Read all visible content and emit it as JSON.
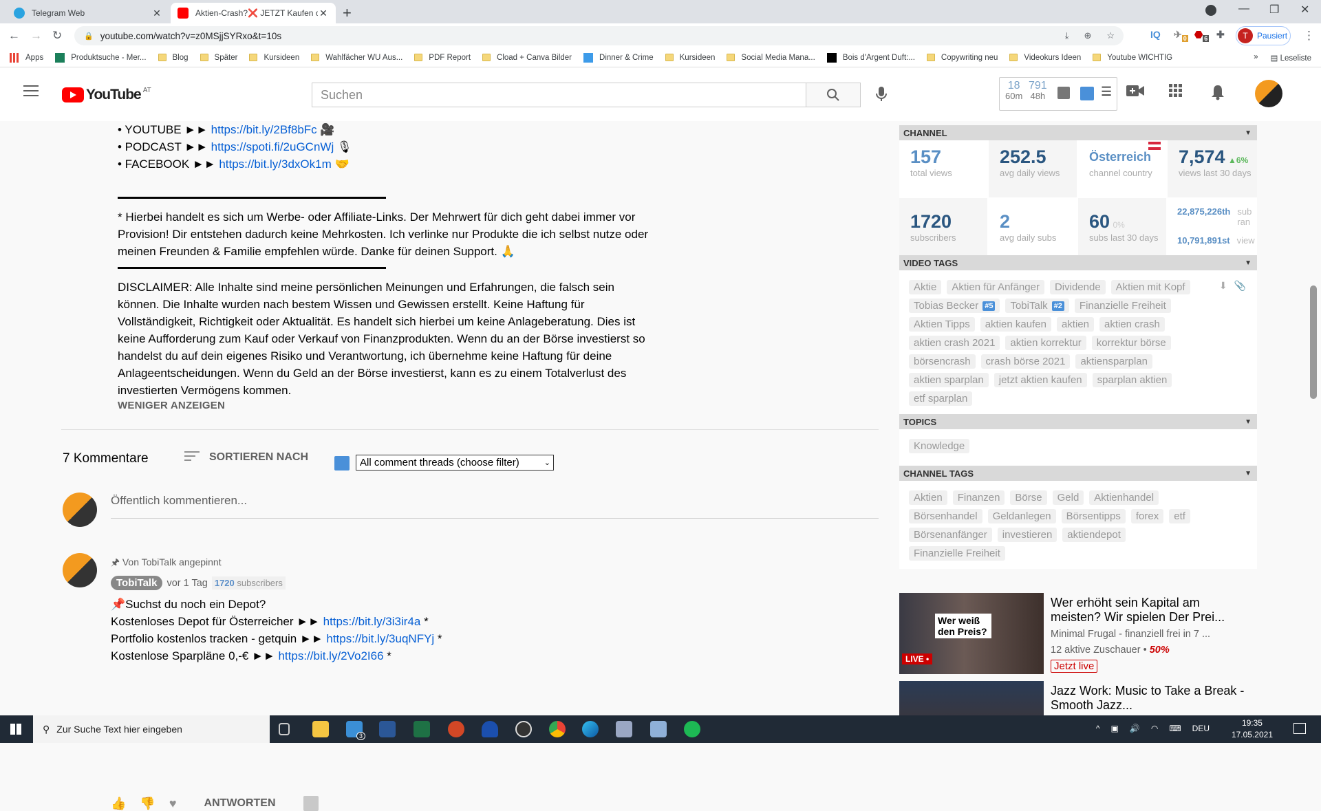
{
  "browser": {
    "tabs": [
      {
        "title": "Telegram Web",
        "active": false
      },
      {
        "title": "Aktien-Crash?❌ JETZT Kaufen o",
        "active": true
      }
    ],
    "url": "youtube.com/watch?v=z0MSjjSYRxo&t=10s",
    "profile_label": "Pausiert",
    "profile_initial": "T",
    "ext_badges": {
      "vidiq": "IQ",
      "ext1_count": "0",
      "adblock_count": "6"
    },
    "bookmarks": [
      {
        "label": "Apps",
        "type": "apps"
      },
      {
        "label": "Produktsuche - Mer...",
        "type": "site"
      },
      {
        "label": "Blog",
        "type": "folder"
      },
      {
        "label": "Später",
        "type": "folder"
      },
      {
        "label": "Kursideen",
        "type": "folder"
      },
      {
        "label": "Wahlfächer WU Aus...",
        "type": "folder"
      },
      {
        "label": "PDF Report",
        "type": "folder"
      },
      {
        "label": "Cload + Canva Bilder",
        "type": "folder"
      },
      {
        "label": "Dinner & Crime",
        "type": "site"
      },
      {
        "label": "Kursideen",
        "type": "folder"
      },
      {
        "label": "Social Media Mana...",
        "type": "folder"
      },
      {
        "label": "Bois d'Argent Duft:...",
        "type": "site"
      },
      {
        "label": "Copywriting neu",
        "type": "folder"
      },
      {
        "label": "Videokurs Ideen",
        "type": "folder"
      },
      {
        "label": "Youtube WICHTIG",
        "type": "folder"
      }
    ],
    "more_bookmarks": "»",
    "reading_list": "Leseliste"
  },
  "youtube": {
    "logo_text": "YouTube",
    "region": "AT",
    "search_placeholder": "Suchen",
    "vidiq_stats": [
      {
        "value": "18",
        "label": "60m"
      },
      {
        "value": "791",
        "label": "48h"
      }
    ]
  },
  "description": {
    "links": [
      {
        "label": "• YOUTUBE ►► ",
        "url": "https://bit.ly/2Bf8bFc",
        "emoji": "🎥"
      },
      {
        "label": "• PODCAST ►► ",
        "url": "https://spoti.fi/2uGCnWj",
        "emoji": "🎙"
      },
      {
        "label": "• FACEBOOK ►► ",
        "url": "https://bit.ly/3dxOk1m",
        "emoji": "🤝"
      }
    ],
    "affiliate_note": "* Hierbei handelt es sich um Werbe- oder Affiliate-Links. Der Mehrwert für dich geht dabei immer vor Provision! Dir entstehen dadurch keine Mehrkosten. Ich verlinke nur Produkte die ich selbst nutze oder meinen Freunden & Familie empfehlen würde. Danke für deinen Support. 🙏",
    "disclaimer": "DISCLAIMER: Alle Inhalte sind meine persönlichen Meinungen und Erfahrungen, die falsch sein können. Die Inhalte wurden nach bestem Wissen und Gewissen erstellt. Keine Haftung für Vollständigkeit, Richtigkeit oder Aktualität. Es handelt sich hierbei um keine Anlageberatung. Dies ist keine Aufforderung zum Kauf oder Verkauf von Finanzprodukten. Wenn du an der Börse investierst so handelst du auf dein eigenes Risiko und Verantwortung, ich übernehme keine Haftung für deine Anlageentscheidungen. Wenn du Geld an der Börse investierst, kann es zu einem Totalverlust des investierten Vermögens kommen.",
    "show_less": "WENIGER ANZEIGEN"
  },
  "comments": {
    "count_label": "7 Kommentare",
    "sort_label": "SORTIEREN NACH",
    "filter_value": "All comment threads (choose filter)",
    "input_placeholder": "Öffentlich kommentieren...",
    "pinned": {
      "pinned_label": "Von TobiTalk angepinnt",
      "author": "TobiTalk",
      "time": "vor 1 Tag",
      "subs_count": "1720",
      "subs_label": "subscribers",
      "lines": [
        {
          "text": "📌Suchst du noch ein Depot?",
          "url": "",
          "suffix": ""
        },
        {
          "text": " Kostenloses Depot für Österreicher ►► ",
          "url": "https://bit.ly/3i3ir4a",
          "suffix": " *"
        },
        {
          "text": "Portfolio kostenlos tracken - getquin ►► ",
          "url": "https://bit.ly/3uqNFYj",
          "suffix": " *"
        },
        {
          "text": "Kostenlose Sparpläne 0,-€ ►► ",
          "url": "https://bit.ly/2Vo2I66",
          "suffix": " *"
        }
      ],
      "reply_label": "ANTWORTEN"
    }
  },
  "vidiq_panel": {
    "channel": {
      "header": "CHANNEL",
      "total_views": {
        "value": "157",
        "label": "total views"
      },
      "avg_daily_views": {
        "value": "252.5",
        "label": "avg daily views"
      },
      "country": {
        "value": "Österreich",
        "label": "channel country"
      },
      "views_30d": {
        "value": "7,574",
        "delta": "▲6%",
        "label": "views last 30 days"
      },
      "subscribers": {
        "value": "1720",
        "label": "subscribers"
      },
      "avg_daily_subs": {
        "value": "2",
        "label": "avg daily subs"
      },
      "subs_30d": {
        "value": "60",
        "delta": "0%",
        "label": "subs last 30 days"
      },
      "sub_rank": {
        "value": "22,875,226th",
        "label": "sub ran"
      },
      "view_rank": {
        "value": "10,791,891st",
        "label": "view"
      }
    },
    "video_tags": {
      "header": "VIDEO TAGS",
      "tags": [
        {
          "text": "Aktie"
        },
        {
          "text": "Aktien für Anfänger"
        },
        {
          "text": "Dividende"
        },
        {
          "text": "Aktien mit Kopf"
        },
        {
          "text": "Tobias Becker",
          "rank": "#5"
        },
        {
          "text": "TobiTalk",
          "rank": "#2"
        },
        {
          "text": "Finanzielle Freiheit"
        },
        {
          "text": "Aktien Tipps"
        },
        {
          "text": "aktien kaufen"
        },
        {
          "text": "aktien"
        },
        {
          "text": "aktien crash"
        },
        {
          "text": "aktien crash 2021"
        },
        {
          "text": "aktien korrektur"
        },
        {
          "text": "korrektur börse"
        },
        {
          "text": "börsencrash"
        },
        {
          "text": "crash börse 2021"
        },
        {
          "text": "aktiensparplan"
        },
        {
          "text": "aktien sparplan"
        },
        {
          "text": "jetzt aktien kaufen"
        },
        {
          "text": "sparplan aktien"
        },
        {
          "text": "etf sparplan"
        }
      ]
    },
    "topics": {
      "header": "TOPICS",
      "tags": [
        "Knowledge"
      ]
    },
    "channel_tags": {
      "header": "CHANNEL TAGS",
      "tags": [
        "Aktien",
        "Finanzen",
        "Börse",
        "Geld",
        "Aktienhandel",
        "Börsenhandel",
        "Geldanlegen",
        "Börsentipps",
        "forex",
        "etf",
        "Börsenanfänger",
        "investieren",
        "aktiendepot",
        "Finanzielle Freiheit"
      ]
    }
  },
  "recommendations": [
    {
      "title": "Wer erhöht sein Kapital am meisten? Wir spielen Der Prei...",
      "channel": "Minimal Frugal - finanziell frei in 7 ...",
      "viewers": "12 aktive Zuschauer",
      "percent": "50%",
      "live_label": "Jetzt live",
      "thumb_text": "Wer weiß den Preis?",
      "thumb_badge": "LIVE •"
    },
    {
      "title": "Jazz Work: Music to Take a Break - Smooth Jazz..."
    }
  ],
  "taskbar": {
    "search_placeholder": "Zur Suche Text hier eingeben",
    "mail_badge": "3",
    "language": "DEU",
    "time": "19:35",
    "date": "17.05.2021"
  }
}
